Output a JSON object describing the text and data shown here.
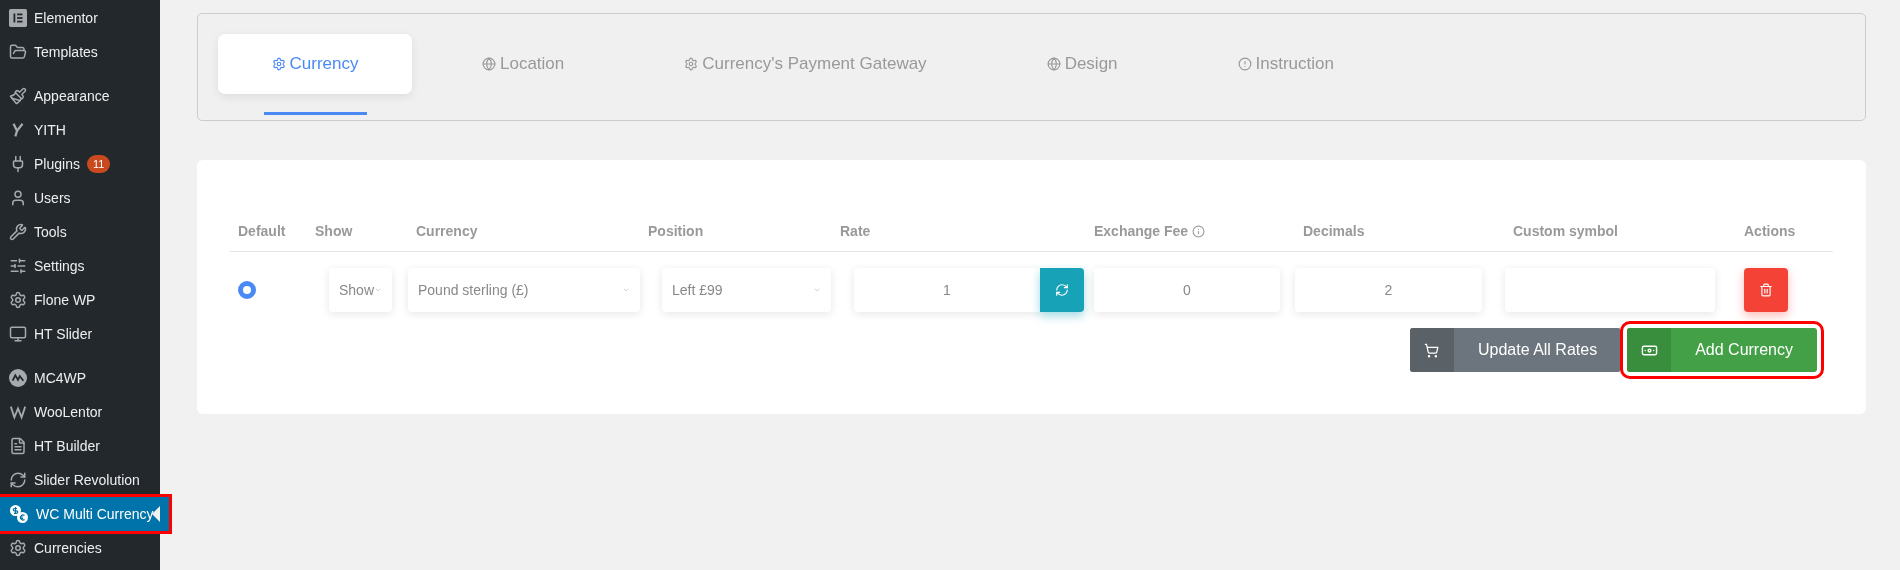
{
  "sidebar": {
    "groups": [
      [
        {
          "label": "Elementor",
          "selected": false,
          "highlighted": false
        },
        {
          "label": "Templates",
          "selected": false,
          "highlighted": false
        }
      ],
      [
        {
          "label": "Appearance",
          "selected": false,
          "highlighted": false
        },
        {
          "label": "YITH",
          "selected": false,
          "highlighted": false
        },
        {
          "label": "Plugins",
          "badge": "11",
          "selected": false,
          "highlighted": false
        },
        {
          "label": "Users",
          "selected": false,
          "highlighted": false
        },
        {
          "label": "Tools",
          "selected": false,
          "highlighted": false
        },
        {
          "label": "Settings",
          "selected": false,
          "highlighted": false
        },
        {
          "label": "Flone WP",
          "selected": false,
          "highlighted": false
        },
        {
          "label": "HT Slider",
          "selected": false,
          "highlighted": false
        }
      ],
      [
        {
          "label": "MC4WP",
          "selected": false,
          "highlighted": false
        },
        {
          "label": "WooLentor",
          "selected": false,
          "highlighted": false
        },
        {
          "label": "HT Builder",
          "selected": false,
          "highlighted": false
        },
        {
          "label": "Slider Revolution",
          "selected": false,
          "highlighted": false
        },
        {
          "label": "WC Multi Currency",
          "selected": true,
          "highlighted": true
        },
        {
          "label": "Currencies",
          "selected": false,
          "highlighted": false
        }
      ]
    ]
  },
  "tabs": [
    {
      "label": "Currency",
      "selected": true
    },
    {
      "label": "Location",
      "selected": false
    },
    {
      "label": "Currency's Payment Gateway",
      "selected": false
    },
    {
      "label": "Design",
      "selected": false
    },
    {
      "label": "Instruction",
      "selected": false
    }
  ],
  "table": {
    "columns": [
      "Default",
      "Show",
      "Currency",
      "Position",
      "Rate",
      "Exchange Fee",
      "Decimals",
      "Custom symbol",
      "Actions"
    ],
    "rows": [
      {
        "default_selected": true,
        "show": "Show",
        "currency": "Pound sterling (£)",
        "position": "Left £99",
        "rate": "1",
        "exchange_fee": "0",
        "decimals": "2"
      }
    ]
  },
  "buttons": [
    {
      "label": "Update All Rates",
      "kind": "update",
      "highlighted": false
    },
    {
      "label": "Add Currency",
      "kind": "add",
      "highlighted": true
    }
  ]
}
